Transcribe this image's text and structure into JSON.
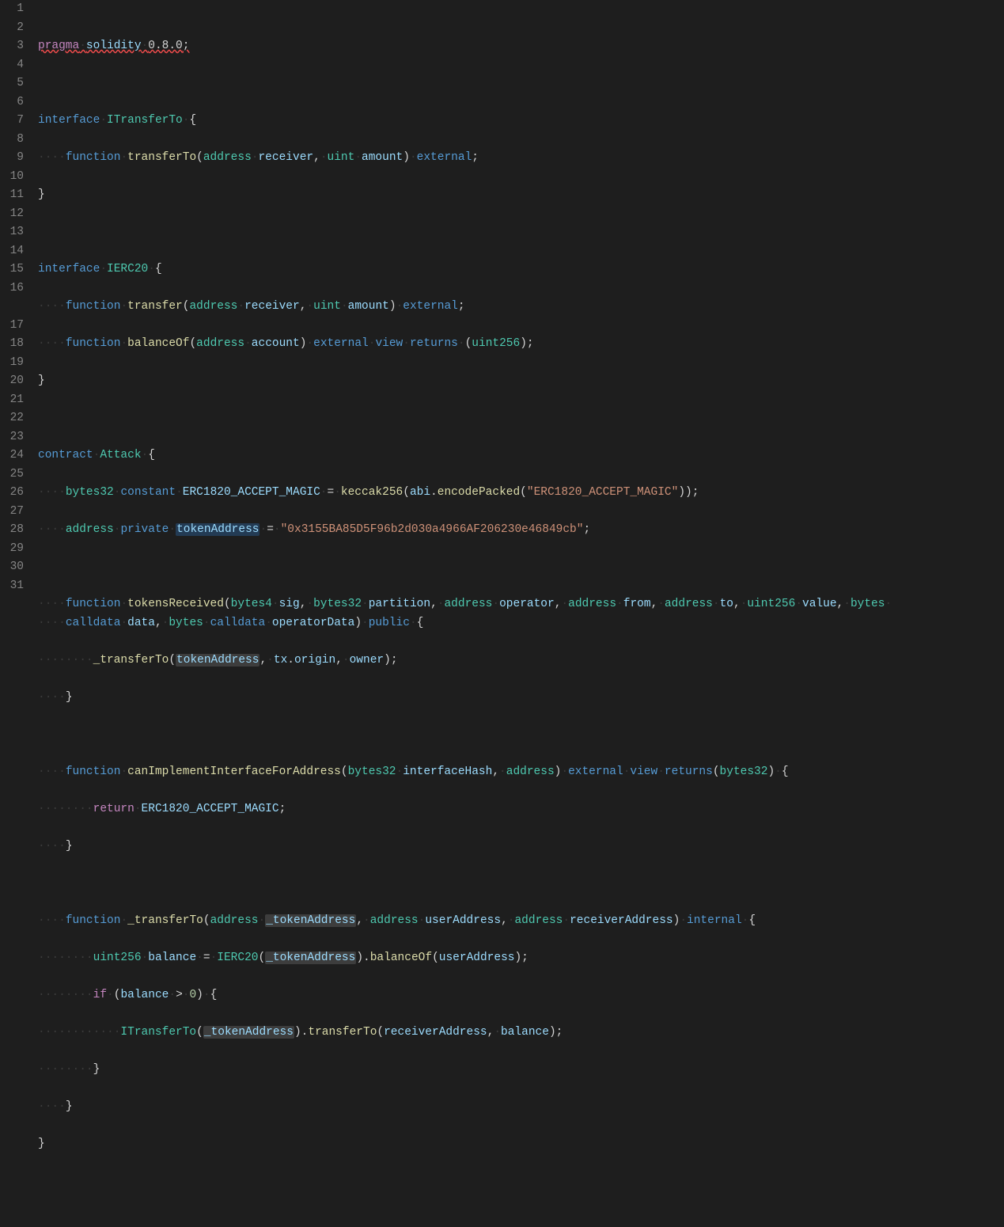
{
  "colors": {
    "background": "#1e1e1e",
    "gutter_fg": "#858585",
    "keyword_pink": "#c586c0",
    "keyword_blue": "#569cd6",
    "type_teal": "#4ec9b0",
    "function_yellow": "#dcdcaa",
    "variable_lightblue": "#9cdcfe",
    "string_orange": "#ce9178",
    "number_green": "#b5cea8",
    "whitespace_guide": "#3b3b3b",
    "selection_word": "rgba(38,79,120,0.6)",
    "selection_ref": "rgba(87,87,87,0.55)",
    "error_squiggle": "#f14c4c"
  },
  "editor": {
    "highlighted_symbol": "tokenAddress",
    "reference_highlights": [
      "tokenAddress",
      "_tokenAddress"
    ],
    "squiggle_range": "pragma solidity 0.8.0;"
  },
  "gutter": {
    "start": 1,
    "end": 31
  },
  "code": {
    "t": {
      "pragma": "pragma",
      "solidity": "solidity",
      "ver": "0.8.0",
      "semi": ";",
      "interface": "interface",
      "ITransferTo": "ITransferTo",
      "IERC20": "IERC20",
      "lbrace": "{",
      "rbrace": "}",
      "function": "function",
      "transferTo": "transferTo",
      "transfer": "transfer",
      "balanceOf": "balanceOf",
      "address": "address",
      "receiver": "receiver",
      "comma": ",",
      "uint": "uint",
      "uint256": "uint256",
      "amount": "amount",
      "account": "account",
      "external": "external",
      "view": "view",
      "returns": "returns",
      "contract": "contract",
      "Attack": "Attack",
      "bytes32": "bytes32",
      "bytes4": "bytes4",
      "bytes": "bytes",
      "constant": "constant",
      "ERC1820_ACCEPT_MAGIC": "ERC1820_ACCEPT_MAGIC",
      "eq": "=",
      "keccak256": "keccak256",
      "abi": "abi",
      "dot": ".",
      "encodePacked": "encodePacked",
      "magic_str": "\"ERC1820_ACCEPT_MAGIC\"",
      "private": "private",
      "tokenAddress": "tokenAddress",
      "addr_str": "\"0x3155BA85D5F96b2d030a4966AF206230e46849cb\"",
      "tokensReceived": "tokensReceived",
      "sig": "sig",
      "partition": "partition",
      "operator": "operator",
      "from": "from",
      "to": "to",
      "value": "value",
      "calldata": "calldata",
      "data": "data",
      "operatorData": "operatorData",
      "public": "public",
      "_transferTo": "_transferTo",
      "tx": "tx",
      "origin": "origin",
      "owner": "owner",
      "canImplementInterfaceForAddress": "canImplementInterfaceForAddress",
      "interfaceHash": "interfaceHash",
      "return": "return",
      "internal": "internal",
      "_tokenAddress": "_tokenAddress",
      "userAddress": "userAddress",
      "receiverAddress": "receiverAddress",
      "balance": "balance",
      "if": "if",
      "gt0": "(balance > 0)",
      "zero": "0",
      "lparen": "(",
      "rparen": ")"
    }
  }
}
